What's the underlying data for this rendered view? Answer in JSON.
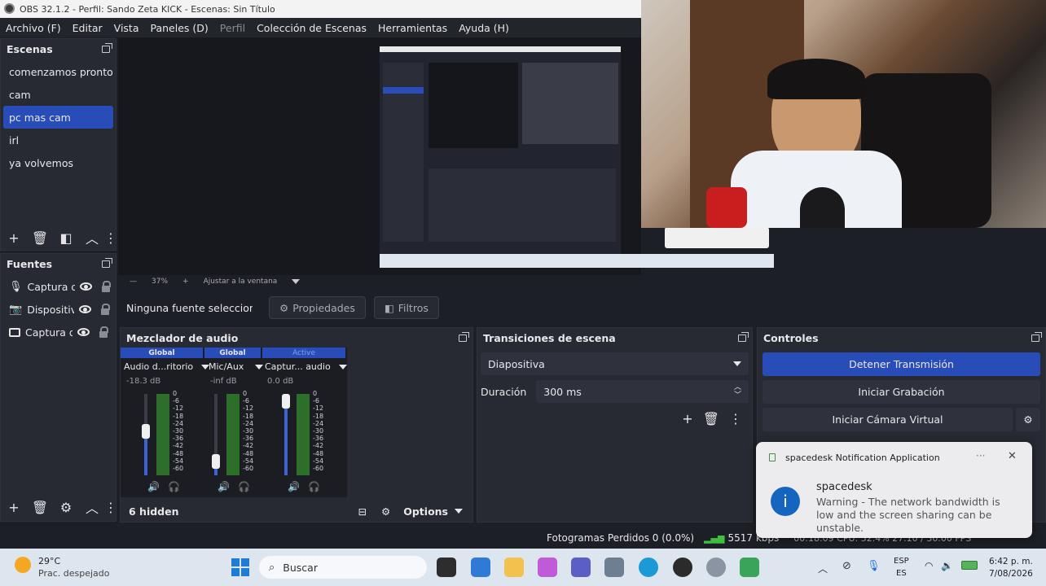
{
  "window": {
    "title": "OBS 32.1.2 - Perfil: Sando Zeta KICK - Escenas: Sin Título"
  },
  "menu": [
    "Archivo (F)",
    "Editar",
    "Vista",
    "Paneles (D)",
    "Perfil",
    "Colección de Escenas",
    "Herramientas",
    "Ayuda (H)"
  ],
  "scenes": {
    "title": "Escenas",
    "items": [
      "comenzamos pronto",
      "cam",
      "pc mas cam",
      "irl",
      "ya volvemos"
    ],
    "selected": "pc mas cam"
  },
  "sources": {
    "title": "Fuentes",
    "items": [
      {
        "label": "Captura d",
        "icon": "microphone-icon"
      },
      {
        "label": "Dispositiv",
        "icon": "camera-icon"
      },
      {
        "label": "Captura d",
        "icon": "monitor-icon"
      }
    ]
  },
  "preview": {
    "zoom": "37%",
    "fit_label": "Ajustar a la ventana"
  },
  "context_bar": {
    "no_source": "Ninguna fuente seleccionada",
    "properties": "Propiedades",
    "filters": "Filtros"
  },
  "mixer": {
    "title": "Mezclador de audio",
    "channels": [
      {
        "tag": "Global",
        "name": "Audio d...ritorio",
        "db": "-18.3 dB",
        "volume": 0.55
      },
      {
        "tag": "Global",
        "name": "Mic/Aux",
        "db": "-inf dB",
        "volume": 0.1
      },
      {
        "tag": "Active",
        "name": "Captur... audio",
        "db": "0.0 dB",
        "volume": 1.0
      }
    ],
    "ticks": [
      "0",
      "-6",
      "-12",
      "-18",
      "-24",
      "-30",
      "-36",
      "-42",
      "-48",
      "-54",
      "-60"
    ],
    "hidden": "6 hidden",
    "options": "Options"
  },
  "transitions": {
    "title": "Transiciones de escena",
    "selected": "Diapositiva",
    "duration_label": "Duración",
    "duration_value": "300 ms"
  },
  "controls": {
    "title": "Controles",
    "stop_stream": "Detener Transmisión",
    "start_recording": "Iniciar Grabación",
    "start_virtual_cam": "Iniciar Cámara Virtual"
  },
  "status": {
    "dropped": "Fotogramas Perdidos 0 (0.0%)",
    "bitrate": "5517 kbps",
    "trailing": "00:18:09    CPU: 52.4%    27.10 / 30.00 FPS"
  },
  "notification": {
    "app": "spacedesk Notification Application",
    "title": "spacedesk",
    "body": "Warning - The network bandwidth is low and the screen sharing can be unstable."
  },
  "taskbar": {
    "weather_temp": "29°C",
    "weather_desc": "Prac. despejado",
    "search": "Buscar",
    "lang1": "ESP",
    "lang2": "ES",
    "time": "6:42 p. m.",
    "date": "7/08/2026"
  },
  "colors": {
    "accent": "#284cb8",
    "panel": "#272a33",
    "background": "#1d1f26"
  }
}
